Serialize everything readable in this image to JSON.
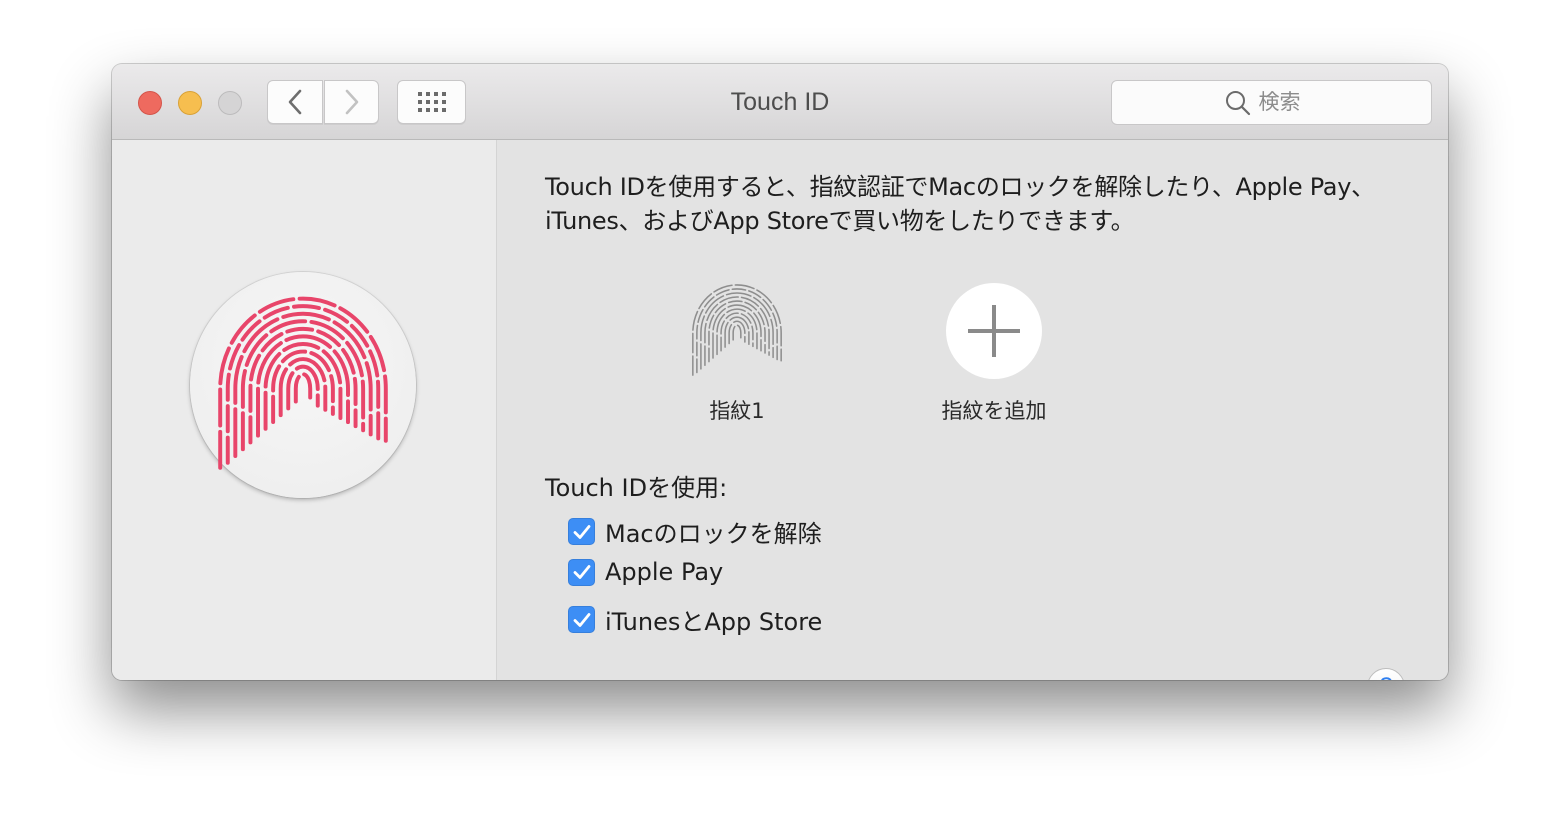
{
  "window": {
    "title": "Touch ID",
    "traffic_lights": [
      "close",
      "minimize",
      "zoom"
    ],
    "nav": {
      "back_icon": "chevron-left-icon",
      "forward_icon": "chevron-right-icon",
      "grid_icon": "show-all-grid-icon"
    },
    "search": {
      "placeholder": "検索",
      "value": "",
      "icon": "search-icon"
    }
  },
  "sidebar": {
    "icon": "touch-id-fingerprint-icon",
    "accent_color": "#e8456a"
  },
  "main": {
    "description": "Touch IDを使用すると、指紋認証でMacのロックを解除したり、Apple Pay、iTunes、およびApp Storeで買い物をしたりできます。",
    "fingerprints": [
      {
        "label": "指紋1",
        "icon": "fingerprint-icon"
      }
    ],
    "add_fingerprint": {
      "label": "指紋を追加",
      "icon": "plus-icon"
    },
    "usage_heading": "Touch IDを使用:",
    "options": [
      {
        "label": "Macのロックを解除",
        "checked": true
      },
      {
        "label": "Apple Pay",
        "checked": true
      },
      {
        "label": "iTunesとApp Store",
        "checked": true
      }
    ],
    "help_label": "?",
    "checkbox_color": "#3d8ef5"
  }
}
